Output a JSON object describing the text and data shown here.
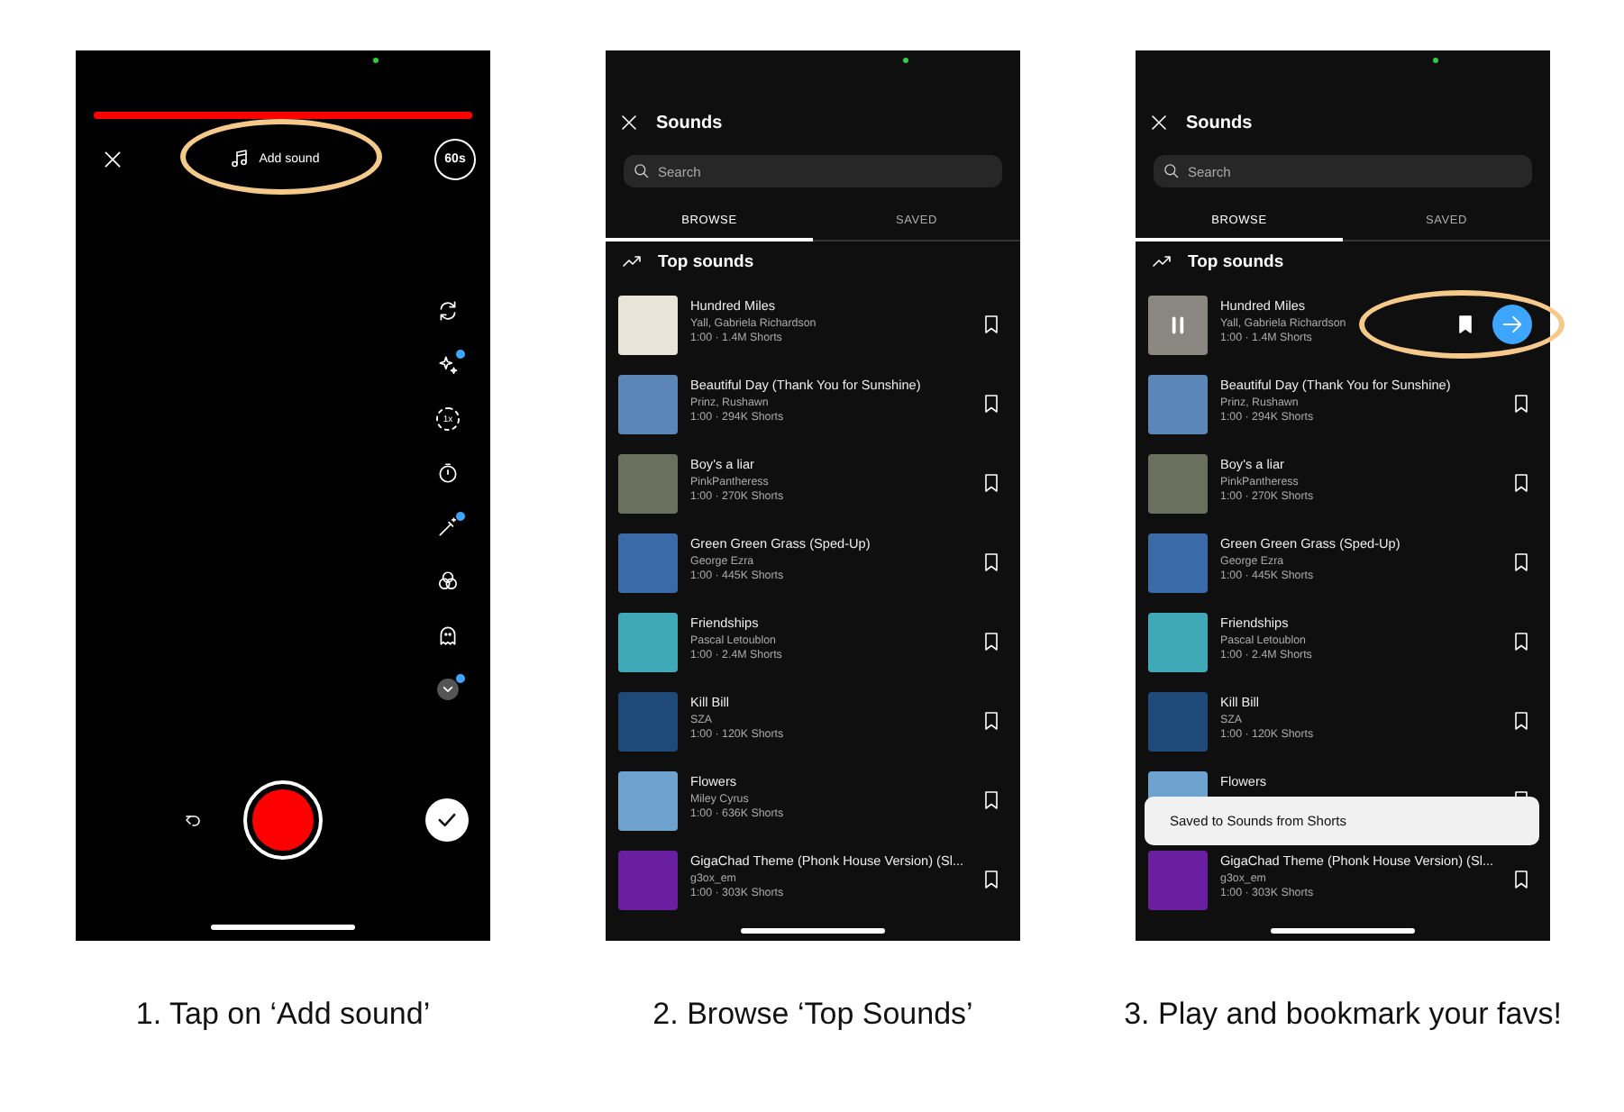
{
  "panels": [
    {
      "kind": "camera",
      "progress": {
        "level": 1
      },
      "add_sound": {
        "label": "Add sound",
        "highlighted": true
      },
      "duration": "60s",
      "tools": [
        {
          "kind": "flip",
          "badge": false
        },
        {
          "kind": "effects",
          "badge": true
        },
        {
          "kind": "speed",
          "label": "1x",
          "badge": false
        },
        {
          "kind": "timer",
          "badge": false
        },
        {
          "kind": "retouch",
          "badge": true
        },
        {
          "kind": "filter",
          "badge": false
        },
        {
          "kind": "ghost",
          "badge": false
        },
        {
          "kind": "more",
          "badge": true
        }
      ],
      "caption": "1. Tap on ‘Add sound’"
    },
    {
      "kind": "sounds",
      "title": "Sounds",
      "search": {
        "placeholder": "Search"
      },
      "tabs": [
        {
          "label": "BROWSE",
          "selected": true
        },
        {
          "label": "SAVED",
          "selected": false
        }
      ],
      "section": "Top sounds",
      "sounds": [
        {
          "title": "Hundred Miles",
          "artist": "Yall, Gabriela Richardson",
          "meta": "1:00 · 1.4M Shorts",
          "playing": false,
          "bookmarked": false,
          "highlighted": false
        },
        {
          "title": "Beautiful Day (Thank You for Sunshine)",
          "artist": "Prinz, Rushawn",
          "meta": "1:00 · 294K Shorts",
          "playing": false,
          "bookmarked": false,
          "highlighted": false
        },
        {
          "title": "Boy's a liar",
          "artist": "PinkPantheress",
          "meta": "1:00 · 270K Shorts",
          "playing": false,
          "bookmarked": false,
          "highlighted": false
        },
        {
          "title": "Green Green Grass (Sped-Up)",
          "artist": "George Ezra",
          "meta": "1:00 · 445K Shorts",
          "playing": false,
          "bookmarked": false,
          "highlighted": false
        },
        {
          "title": "Friendships",
          "artist": "Pascal Letoublon",
          "meta": "1:00 · 2.4M Shorts",
          "playing": false,
          "bookmarked": false,
          "highlighted": false
        },
        {
          "title": "Kill Bill",
          "artist": "SZA",
          "meta": "1:00 · 120K Shorts",
          "playing": false,
          "bookmarked": false,
          "highlighted": false
        },
        {
          "title": "Flowers",
          "artist": "Miley Cyrus",
          "meta": "1:00 · 636K Shorts",
          "playing": false,
          "bookmarked": false,
          "highlighted": false
        },
        {
          "title": "GigaChad Theme (Phonk House Version) (Sl...",
          "artist": "g3ox_em",
          "meta": "1:00 · 303K Shorts",
          "playing": false,
          "bookmarked": false,
          "highlighted": false
        }
      ],
      "caption": "2. Browse ‘Top Sounds’"
    },
    {
      "kind": "sounds",
      "title": "Sounds",
      "search": {
        "placeholder": "Search"
      },
      "tabs": [
        {
          "label": "BROWSE",
          "selected": true
        },
        {
          "label": "SAVED",
          "selected": false
        }
      ],
      "section": "Top sounds",
      "sounds": [
        {
          "title": "Hundred Miles",
          "artist": "Yall, Gabriela Richardson",
          "meta": "1:00 · 1.4M Shorts",
          "playing": true,
          "bookmarked": true,
          "highlighted": true
        },
        {
          "title": "Beautiful Day (Thank You for Sunshine)",
          "artist": "Prinz, Rushawn",
          "meta": "1:00 · 294K Shorts",
          "playing": false,
          "bookmarked": false,
          "highlighted": false
        },
        {
          "title": "Boy's a liar",
          "artist": "PinkPantheress",
          "meta": "1:00 · 270K Shorts",
          "playing": false,
          "bookmarked": false,
          "highlighted": false
        },
        {
          "title": "Green Green Grass (Sped-Up)",
          "artist": "George Ezra",
          "meta": "1:00 · 445K Shorts",
          "playing": false,
          "bookmarked": false,
          "highlighted": false
        },
        {
          "title": "Friendships",
          "artist": "Pascal Letoublon",
          "meta": "1:00 · 2.4M Shorts",
          "playing": false,
          "bookmarked": false,
          "highlighted": false
        },
        {
          "title": "Kill Bill",
          "artist": "SZA",
          "meta": "1:00 · 120K Shorts",
          "playing": false,
          "bookmarked": false,
          "highlighted": false
        },
        {
          "title": "Flowers",
          "playing": false,
          "bookmarked": false,
          "highlighted": false
        },
        {
          "title": "GigaChad Theme (Phonk House Version) (Sl...",
          "artist": "g3ox_em",
          "meta": "1:00 · 303K Shorts",
          "playing": false,
          "bookmarked": false,
          "highlighted": false
        }
      ],
      "toast": "Saved to Sounds from Shorts",
      "caption": "3. Play and bookmark your favs!"
    }
  ]
}
